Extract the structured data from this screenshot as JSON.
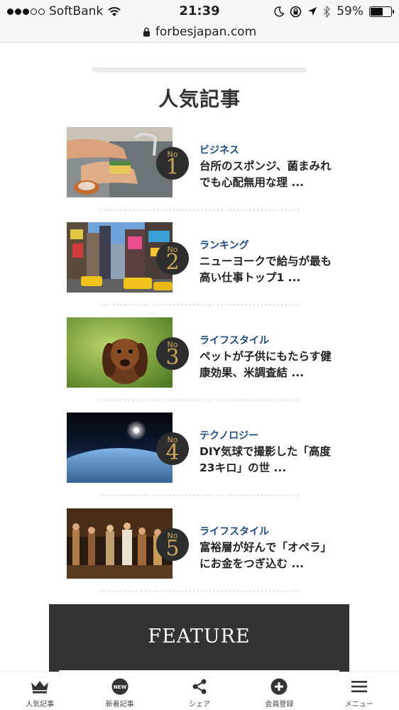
{
  "status": {
    "carrier": "SoftBank",
    "time": "21:39",
    "battery": "59%",
    "battery_level": 0.59
  },
  "browser": {
    "url": "forbesjapan.com"
  },
  "section": {
    "title": "人気記事"
  },
  "articles": [
    {
      "rank_prefix": "No",
      "rank": "1",
      "category": "ビジネス",
      "title": "台所のスポンジ、菌まみれでも心配無用な理 ..."
    },
    {
      "rank_prefix": "No",
      "rank": "2",
      "category": "ランキング",
      "title": "ニューヨークで給与が最も高い仕事トップ1 ..."
    },
    {
      "rank_prefix": "No",
      "rank": "3",
      "category": "ライフスタイル",
      "title": "ペットが子供にもたらす健康効果、米調査結 ..."
    },
    {
      "rank_prefix": "No",
      "rank": "4",
      "category": "テクノロジー",
      "title": "DIY気球で撮影した「高度23キロ」の世 ..."
    },
    {
      "rank_prefix": "No",
      "rank": "5",
      "category": "ライフスタイル",
      "title": "富裕層が好んで「オペラ」にお金をつぎ込む ..."
    }
  ],
  "feature": {
    "title": "FEATURE"
  },
  "tabbar": {
    "items": [
      {
        "label": "人気記事",
        "icon": "crown-icon"
      },
      {
        "label": "新着記事",
        "icon": "new-badge-icon",
        "badge": "NEW"
      },
      {
        "label": "シェア",
        "icon": "share-icon"
      },
      {
        "label": "会員登録",
        "icon": "plus-circle-icon"
      },
      {
        "label": "メニュー",
        "icon": "hamburger-menu-icon"
      }
    ]
  },
  "colors": {
    "category": "#1f4c7d",
    "rank_gold": "#c9a65a",
    "badge_bg": "#2d2d2d",
    "feature_bg": "#333333"
  }
}
